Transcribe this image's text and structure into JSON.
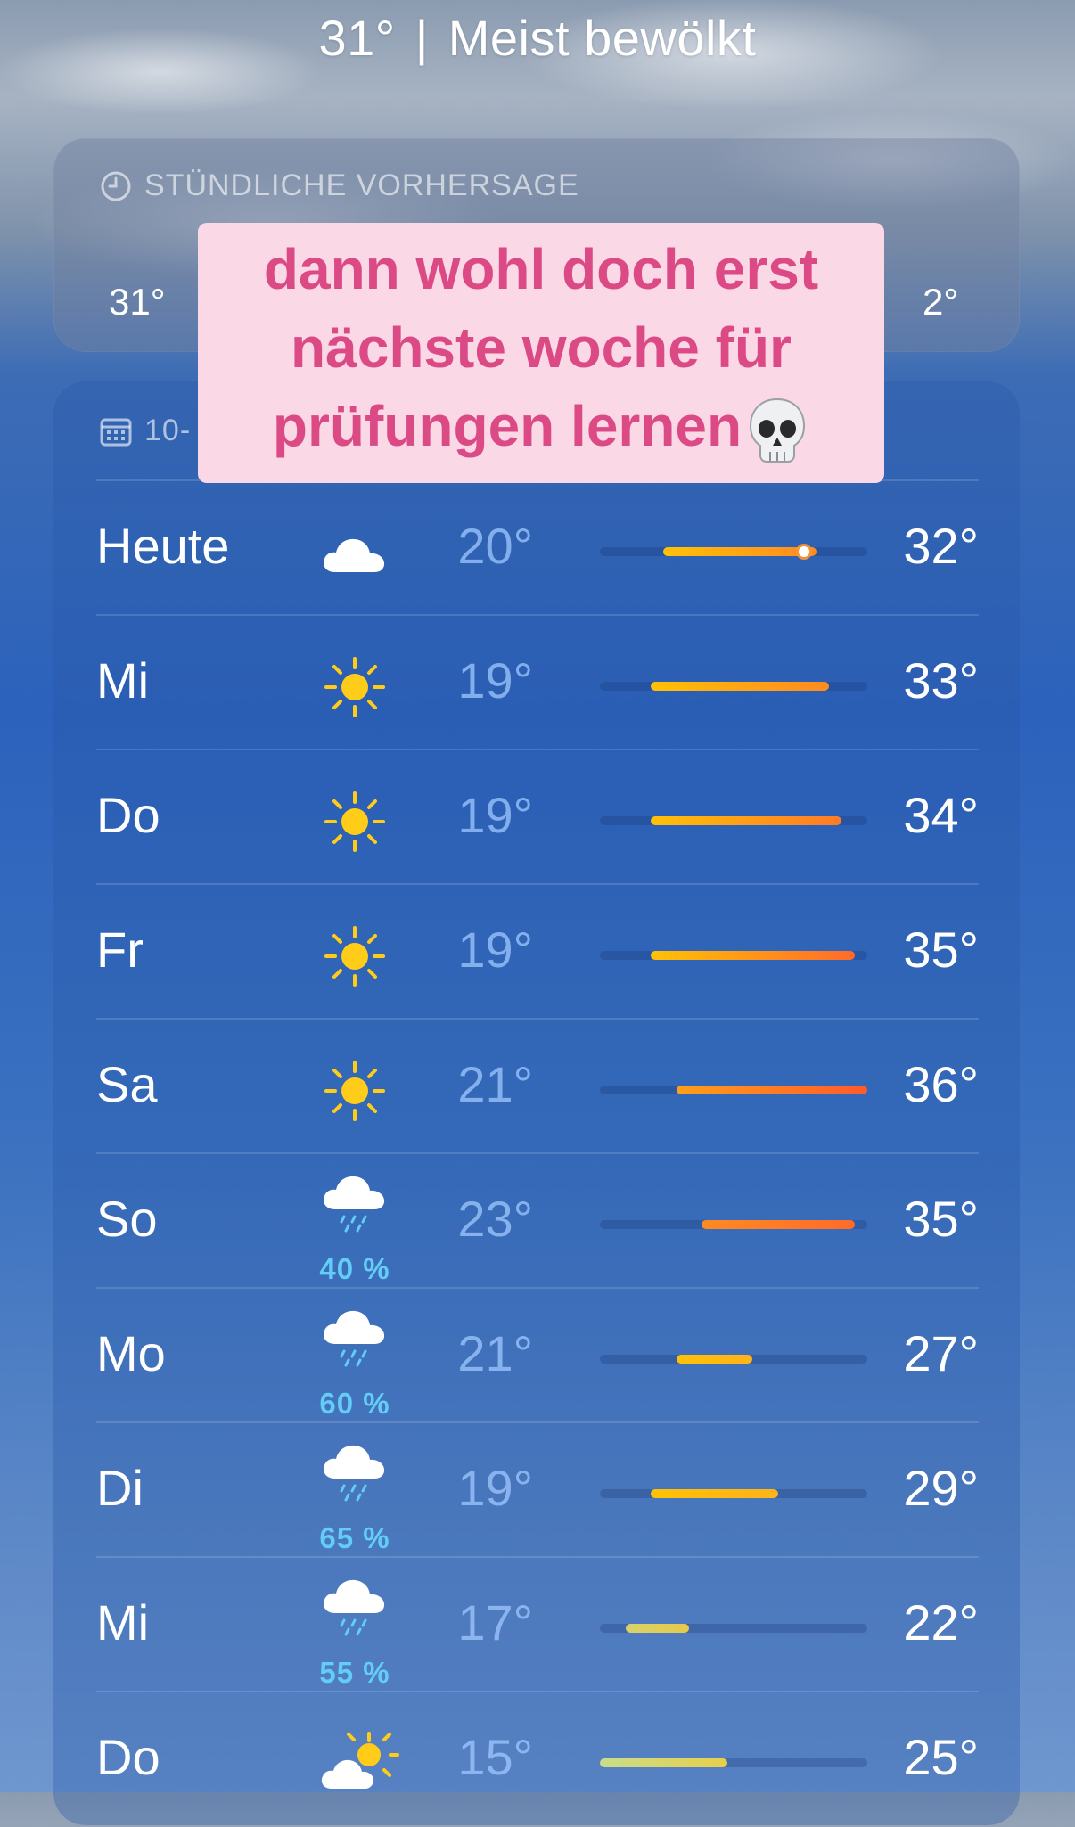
{
  "header": {
    "current_temp": "31°",
    "condition": "Meist bewölkt"
  },
  "hourly": {
    "title": "STÜNDLICHE VORHERSAGE",
    "icon": "clock-icon",
    "visible_temps": {
      "first": "31°",
      "last_partial": "2°"
    }
  },
  "daily": {
    "title_partial": "10-",
    "icon": "calendar-icon",
    "scale_min": 15,
    "scale_max": 36,
    "rows": [
      {
        "day": "Heute",
        "icon": "cloud",
        "precip": "",
        "low": "20°",
        "high": "32°",
        "low_value": 20,
        "high_value": 32,
        "current_value": 31,
        "colors": [
          "#ffc107",
          "#ff8a22"
        ]
      },
      {
        "day": "Mi",
        "icon": "sun",
        "precip": "",
        "low": "19°",
        "high": "33°",
        "low_value": 19,
        "high_value": 33,
        "colors": [
          "#ffc107",
          "#ff8a22"
        ]
      },
      {
        "day": "Do",
        "icon": "sun",
        "precip": "",
        "low": "19°",
        "high": "34°",
        "low_value": 19,
        "high_value": 34,
        "colors": [
          "#ffc107",
          "#ff7a28"
        ]
      },
      {
        "day": "Fr",
        "icon": "sun",
        "precip": "",
        "low": "19°",
        "high": "35°",
        "low_value": 19,
        "high_value": 35,
        "colors": [
          "#ffc107",
          "#ff6b2a"
        ]
      },
      {
        "day": "Sa",
        "icon": "sun",
        "precip": "",
        "low": "21°",
        "high": "36°",
        "low_value": 21,
        "high_value": 36,
        "colors": [
          "#ff9f1c",
          "#ff5a2c"
        ]
      },
      {
        "day": "So",
        "icon": "rain",
        "precip": "40 %",
        "low": "23°",
        "high": "35°",
        "low_value": 23,
        "high_value": 35,
        "colors": [
          "#ff8a22",
          "#ff6b2a"
        ]
      },
      {
        "day": "Mo",
        "icon": "rain",
        "precip": "60 %",
        "low": "21°",
        "high": "27°",
        "low_value": 21,
        "high_value": 27,
        "colors": [
          "#ffc107",
          "#ffb319"
        ]
      },
      {
        "day": "Di",
        "icon": "rain",
        "precip": "65 %",
        "low": "19°",
        "high": "29°",
        "low_value": 19,
        "high_value": 29,
        "colors": [
          "#ffc107",
          "#ffb319"
        ]
      },
      {
        "day": "Mi",
        "icon": "rain",
        "precip": "55 %",
        "low": "17°",
        "high": "22°",
        "low_value": 17,
        "high_value": 22,
        "colors": [
          "#d9d36a",
          "#e6c94a"
        ]
      },
      {
        "day": "Do",
        "icon": "partly-sunny",
        "precip": "",
        "low": "15°",
        "high": "25°",
        "low_value": 15,
        "high_value": 25,
        "colors": [
          "#c9dd8a",
          "#e8cf4a"
        ]
      }
    ]
  },
  "caption": {
    "lines": [
      "dann wohl doch erst",
      "nächste woche für",
      "prüfungen lernen"
    ],
    "emoji": "skull-icon"
  }
}
